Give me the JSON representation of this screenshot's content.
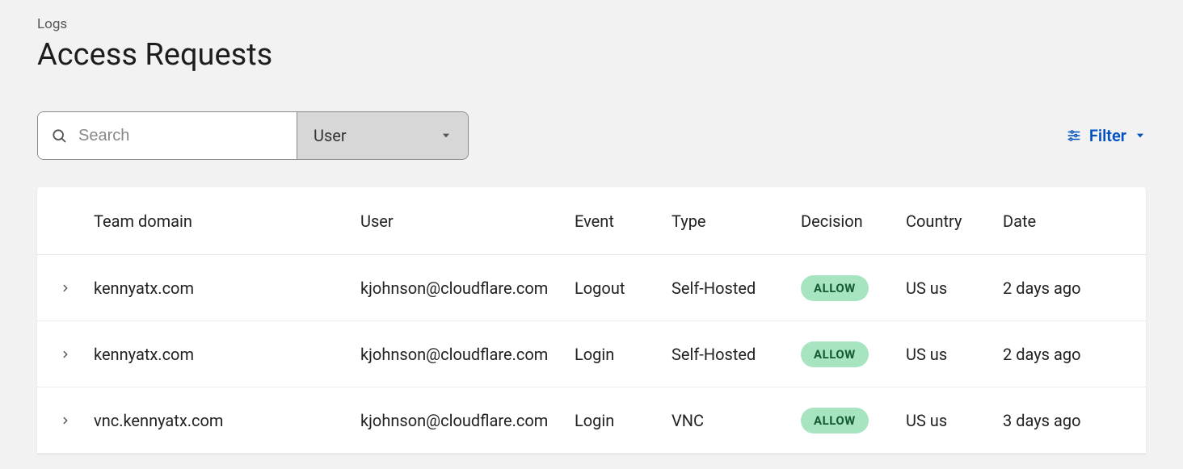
{
  "breadcrumb": "Logs",
  "page_title": "Access Requests",
  "search": {
    "placeholder": "Search",
    "select_label": "User"
  },
  "filter": {
    "label": "Filter"
  },
  "table": {
    "headers": {
      "team_domain": "Team domain",
      "user": "User",
      "event": "Event",
      "type": "Type",
      "decision": "Decision",
      "country": "Country",
      "date": "Date"
    },
    "rows": [
      {
        "team_domain": "kennyatx.com",
        "user": "kjohnson@cloudflare.com",
        "event": "Logout",
        "type": "Self-Hosted",
        "decision": "ALLOW",
        "country": "US us",
        "date": "2 days ago"
      },
      {
        "team_domain": "kennyatx.com",
        "user": "kjohnson@cloudflare.com",
        "event": "Login",
        "type": "Self-Hosted",
        "decision": "ALLOW",
        "country": "US us",
        "date": "2 days ago"
      },
      {
        "team_domain": "vnc.kennyatx.com",
        "user": "kjohnson@cloudflare.com",
        "event": "Login",
        "type": "VNC",
        "decision": "ALLOW",
        "country": "US us",
        "date": "3 days ago"
      }
    ]
  }
}
